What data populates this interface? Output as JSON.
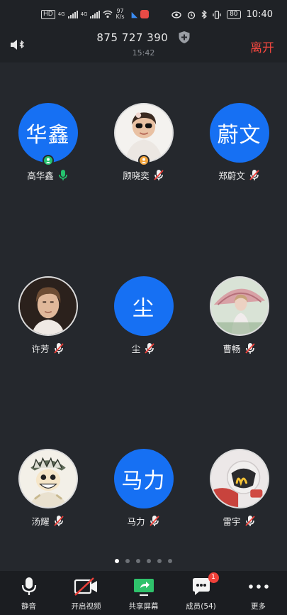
{
  "status_bar": {
    "hd": "HD",
    "net1": "4G",
    "net2": "4G",
    "speed_value": "97",
    "speed_unit": "K/s",
    "battery": "80",
    "time": "10:40"
  },
  "header": {
    "meeting_id": "875 727 390",
    "elapsed": "15:42",
    "leave_label": "离开"
  },
  "participants": [
    {
      "name": "高华鑫",
      "avatar_text": "华鑫",
      "avatar": "text",
      "badge": "host",
      "mic": "on"
    },
    {
      "name": "顾晓奕",
      "avatar_text": "",
      "avatar": "photo-child",
      "badge": "cohost",
      "mic": "muted"
    },
    {
      "name": "郑蔚文",
      "avatar_text": "蔚文",
      "avatar": "text",
      "badge": "",
      "mic": "muted"
    },
    {
      "name": "许芳",
      "avatar_text": "",
      "avatar": "photo-man",
      "badge": "",
      "mic": "muted"
    },
    {
      "name": "尘",
      "avatar_text": "尘",
      "avatar": "text",
      "badge": "",
      "mic": "muted"
    },
    {
      "name": "曹畅",
      "avatar_text": "",
      "avatar": "photo-umbrella",
      "badge": "",
      "mic": "muted"
    },
    {
      "name": "汤耀",
      "avatar_text": "",
      "avatar": "photo-cartoon",
      "badge": "",
      "mic": "muted"
    },
    {
      "name": "马力",
      "avatar_text": "马力",
      "avatar": "text",
      "badge": "",
      "mic": "muted"
    },
    {
      "name": "雷宇",
      "avatar_text": "",
      "avatar": "photo-helmet",
      "badge": "",
      "mic": "muted"
    }
  ],
  "pagination": {
    "pages": 6,
    "current": 1
  },
  "toolbar": {
    "mute_label": "静音",
    "video_label": "开启视频",
    "share_label": "共享屏幕",
    "members_label": "成员(54)",
    "members_badge": "1",
    "more_label": "更多"
  },
  "colors": {
    "background": "#25282d",
    "avatar_blue": "#1670f3",
    "leave_red": "#f2473f",
    "mic_green": "#25c26e",
    "cohost_orange": "#f3a33a"
  }
}
